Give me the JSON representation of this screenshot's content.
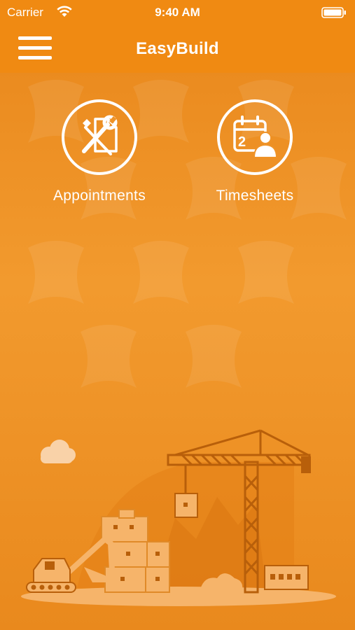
{
  "status_bar": {
    "carrier": "Carrier",
    "time": "9:40 AM",
    "wifi_icon": "wifi-icon",
    "battery_icon": "battery-icon"
  },
  "nav": {
    "title": "EasyBuild",
    "menu_icon": "hamburger-menu-icon"
  },
  "tiles": [
    {
      "label": "Appointments",
      "icon": "tools-document-icon"
    },
    {
      "label": "Timesheets",
      "icon": "calendar-person-icon"
    }
  ],
  "theme": {
    "primary": "#f08a12",
    "background": "#ef9327",
    "illustration_shade": "#f6b46a",
    "text": "#ffffff"
  },
  "illustration": "construction-site-illustration",
  "calendar_icon_text": "2"
}
